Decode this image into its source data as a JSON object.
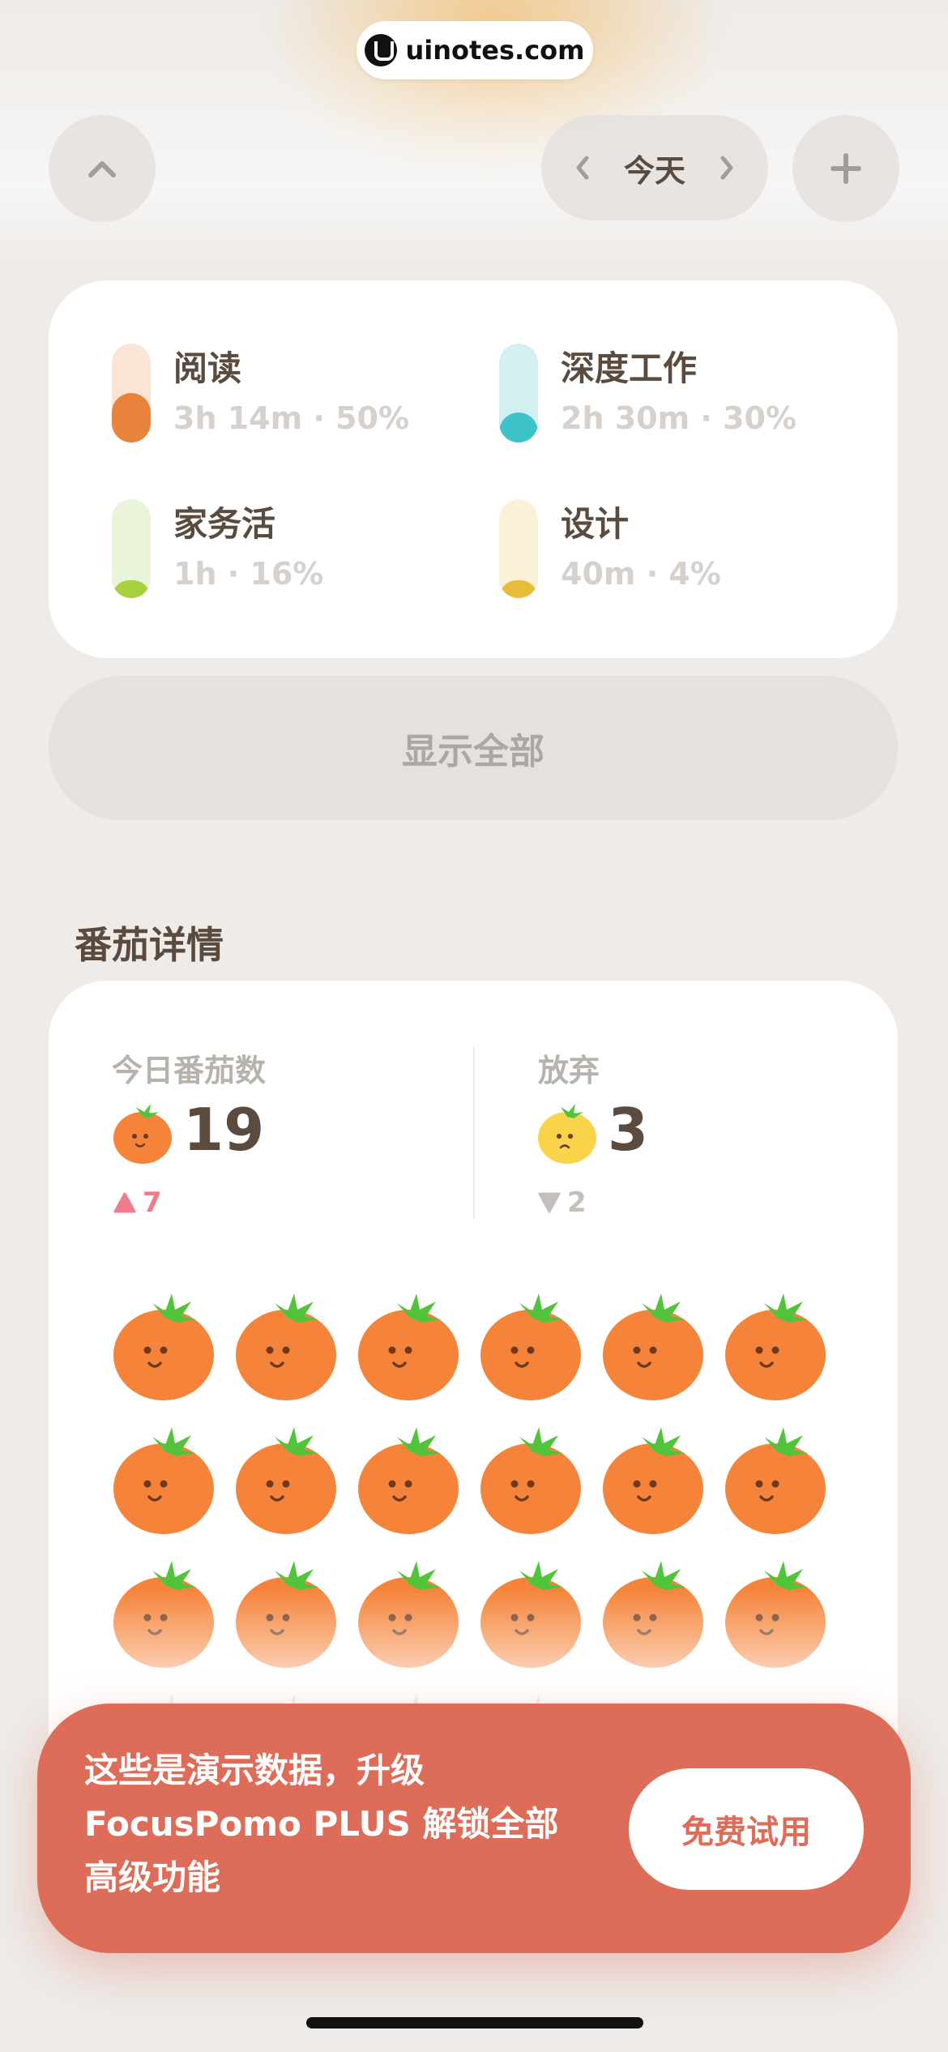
{
  "watermark": {
    "text": "uinotes.com"
  },
  "header": {
    "collapse_icon": "chevron-up-icon",
    "date_label": "今天",
    "prev_icon": "chevron-left-icon",
    "next_icon": "chevron-right-icon",
    "add_icon": "plus-icon"
  },
  "categories": [
    {
      "name": "阅读",
      "stat": "3h 14m · 50%",
      "fraction": 0.5,
      "color": "#e8833c",
      "track": "#fbe4d6"
    },
    {
      "name": "深度工作",
      "stat": "2h 30m · 30%",
      "fraction": 0.3,
      "color": "#3ec3c8",
      "track": "#d3f0f1"
    },
    {
      "name": "家务活",
      "stat": "1h · 16%",
      "fraction": 0.16,
      "color": "#a6d03e",
      "track": "#eaf4d8"
    },
    {
      "name": "设计",
      "stat": "40m · 4%",
      "fraction": 0.04,
      "color": "#e6bc3a",
      "track": "#faf1d6"
    }
  ],
  "show_all_label": "显示全部",
  "section_title": "番茄详情",
  "stats": {
    "today_label": "今日番茄数",
    "today_value": "19",
    "today_delta": "7",
    "abandon_label": "放弃",
    "abandon_value": "3",
    "abandon_delta": "2"
  },
  "tomato_count_visible": 22,
  "banner": {
    "line1": "这些是演示数据，升级",
    "line2": "FocusPomo PLUS 解锁全部",
    "line3": "高级功能",
    "button_label": "免费试用"
  },
  "colors": {
    "accent": "#dd6c58",
    "tomato": "#f5843a",
    "leaf": "#52c43b",
    "up_delta": "#f07c8a",
    "down_delta": "#c4bfba"
  }
}
